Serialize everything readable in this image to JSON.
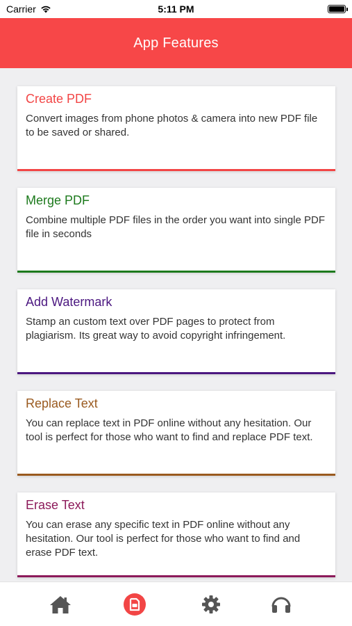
{
  "status": {
    "carrier": "Carrier",
    "time": "5:11 PM"
  },
  "header": {
    "title": "App Features"
  },
  "features": [
    {
      "title": "Create PDF",
      "description": "Convert images from phone photos & camera into new PDF file to be saved or shared.",
      "color": "#f24545"
    },
    {
      "title": "Merge PDF",
      "description": "Combine multiple PDF files in the order you want into single PDF file in seconds",
      "color": "#1d7a1d"
    },
    {
      "title": "Add Watermark",
      "description": "Stamp an custom text over PDF pages to protect from plagiarism. Its great way to avoid copyright infringement.",
      "color": "#4b1780"
    },
    {
      "title": "Replace Text",
      "description": "You can replace text in PDF online without any hesitation. Our tool is perfect for those who want to find and replace PDF text.",
      "color": "#9a5a1f"
    },
    {
      "title": "Erase Text",
      "description": "You can erase any specific text in PDF online without any hesitation. Our tool is perfect for those who want to find and erase PDF text.",
      "color": "#8c1a5a"
    }
  ],
  "tabs": [
    {
      "icon": "home-icon",
      "active": false
    },
    {
      "icon": "pdf-app-icon",
      "active": true
    },
    {
      "icon": "gear-icon",
      "active": false
    },
    {
      "icon": "headphones-icon",
      "active": false
    }
  ],
  "colors": {
    "header": "#f74748",
    "accent": "#f24545",
    "tab_inactive": "#555555"
  }
}
